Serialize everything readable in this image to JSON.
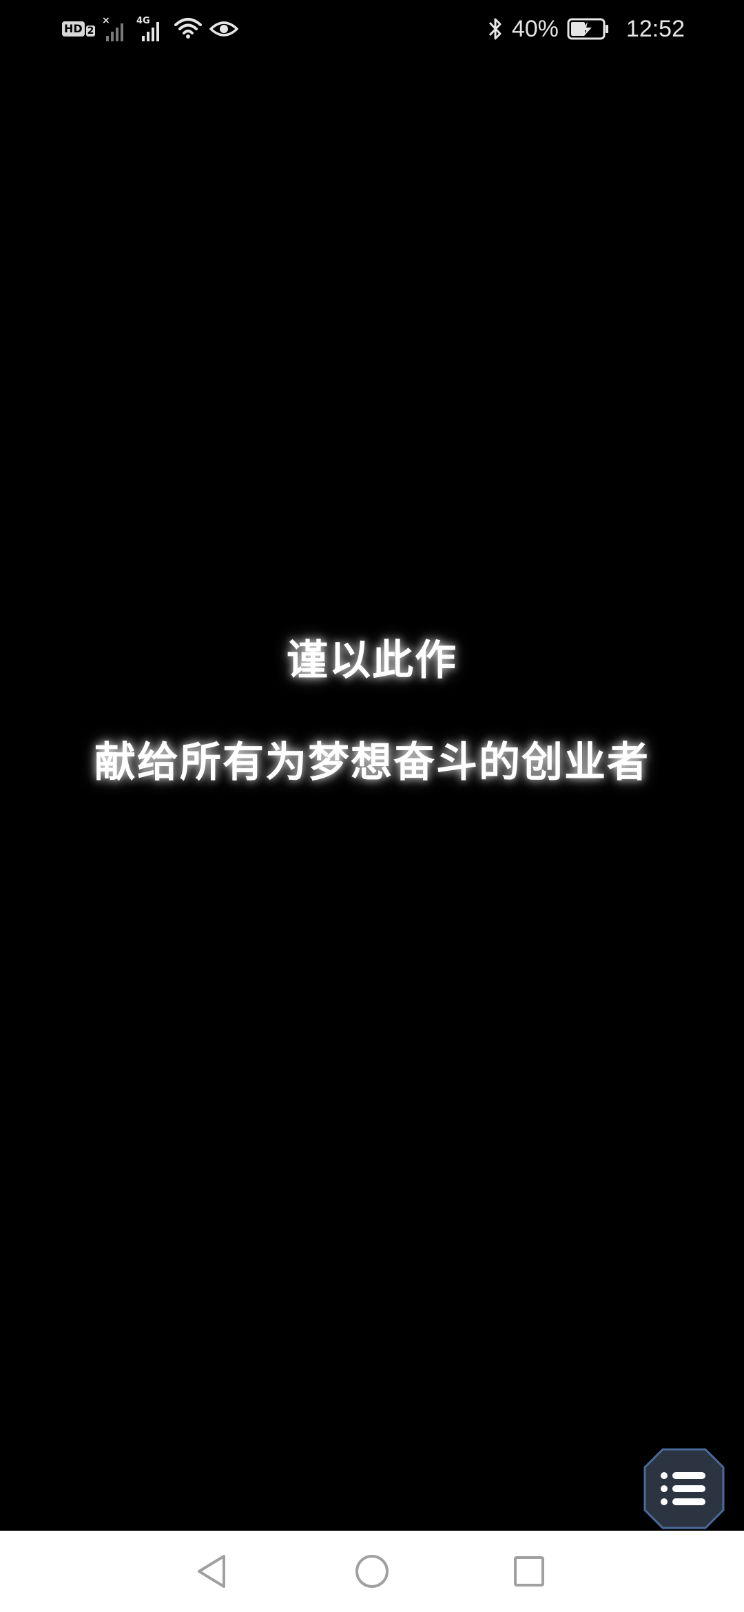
{
  "status_bar": {
    "hd_label": "HD",
    "hd_sub": "2",
    "network_type": "4G",
    "battery_percent": "40%",
    "time": "12:52",
    "icons": [
      "hd-icon",
      "signal-no-service-icon",
      "signal-4g-icon",
      "wifi-icon",
      "eye-icon",
      "bluetooth-icon",
      "battery-charging-icon"
    ]
  },
  "content": {
    "line1": "谨以此作",
    "line2": "献给所有为梦想奋斗的创业者"
  },
  "floating_button": {
    "icon": "list-menu-icon",
    "colors": {
      "background": "#2c3442",
      "border": "#4a6a9a",
      "icon": "#ffffff"
    }
  },
  "navigation_bar": {
    "buttons": [
      "back-icon",
      "home-icon",
      "recent-apps-icon"
    ],
    "background": "#ffffff",
    "icon_color": "#a0a0a0"
  }
}
